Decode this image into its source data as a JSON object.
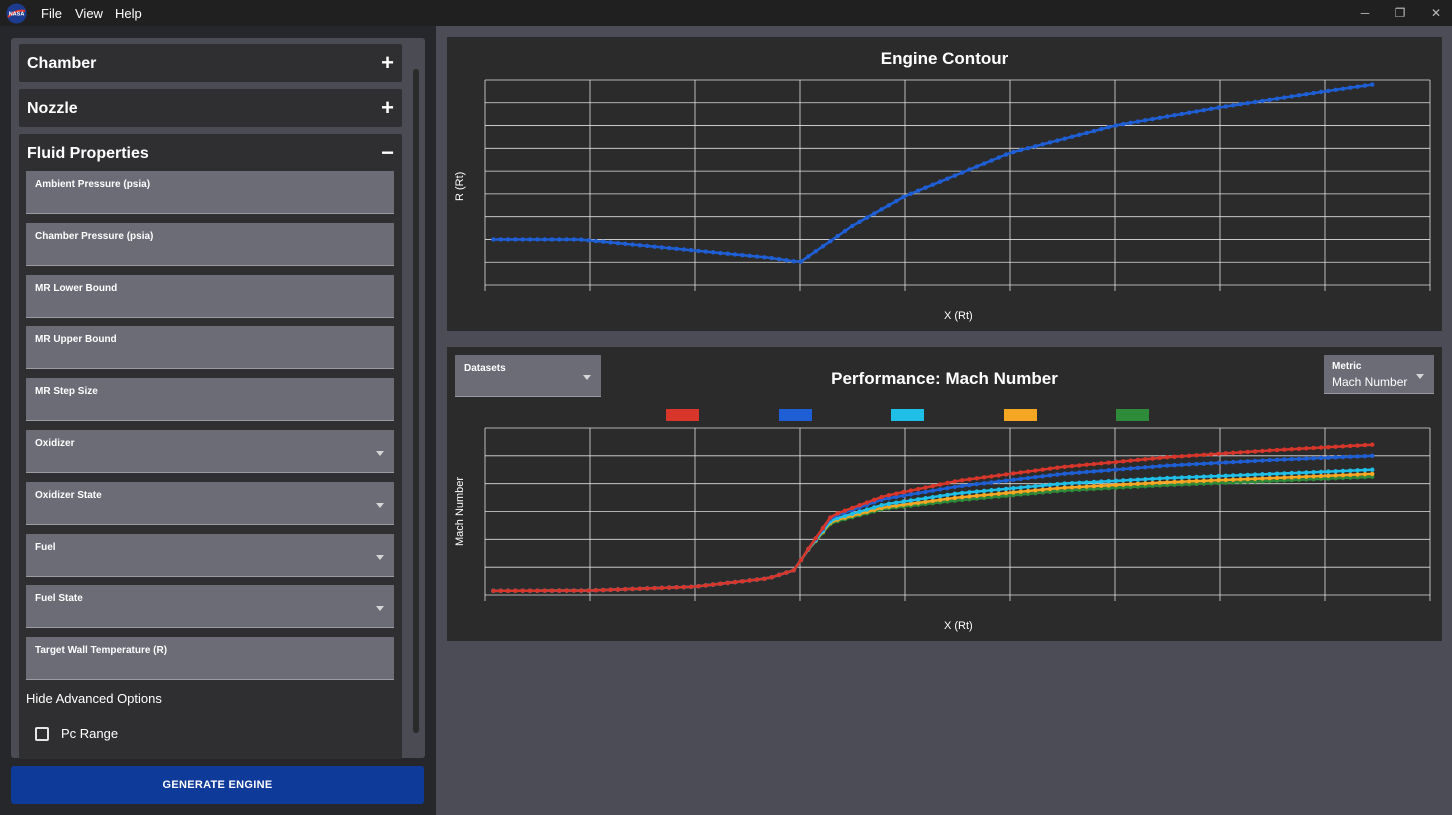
{
  "menu": {
    "items": [
      "File",
      "View",
      "Help"
    ]
  },
  "window_controls": {
    "minimize": "─",
    "restore": "❐",
    "close": "✕"
  },
  "sections": [
    {
      "title": "Chamber",
      "toggle": "+"
    },
    {
      "title": "Nozzle",
      "toggle": "+"
    },
    {
      "title": "Fluid Properties",
      "toggle": "−"
    }
  ],
  "fields": [
    {
      "label": "Ambient Pressure (psia)",
      "dropdown": false
    },
    {
      "label": "Chamber Pressure (psia)",
      "dropdown": false
    },
    {
      "label": "MR Lower Bound",
      "dropdown": false
    },
    {
      "label": "MR Upper Bound",
      "dropdown": false
    },
    {
      "label": "MR Step Size",
      "dropdown": false
    },
    {
      "label": "Oxidizer",
      "dropdown": true
    },
    {
      "label": "Oxidizer State",
      "dropdown": true
    },
    {
      "label": "Fuel",
      "dropdown": true
    },
    {
      "label": "Fuel State",
      "dropdown": true
    },
    {
      "label": "Target Wall Temperature (R)",
      "dropdown": false
    }
  ],
  "advanced": {
    "toggle_label": "Hide Advanced Options",
    "pc_range_label": "Pc Range",
    "pc_range_checked": false
  },
  "generate_button": "GENERATE ENGINE",
  "contour_panel": {
    "title": "Engine Contour",
    "xlabel": "X (Rt)",
    "ylabel": "R (Rt)"
  },
  "performance_panel": {
    "title": "Performance: Mach Number",
    "xlabel": "X (Rt)",
    "ylabel": "Mach Number",
    "datasets_label": "Datasets",
    "metric_label": "Metric",
    "metric_value": "Mach Number"
  },
  "colors": {
    "contour_line": "#1f5fd6",
    "grid": "#e0e0e0",
    "series": [
      "#d9362b",
      "#1f5fd6",
      "#1fbfe8",
      "#f5a623",
      "#2e8b3a"
    ]
  },
  "chart_data": [
    {
      "type": "scatter",
      "title": "Engine Contour",
      "xlabel": "X (Rt)",
      "ylabel": "R (Rt)",
      "grid": true,
      "xlim": [
        0,
        9
      ],
      "ylim": [
        0,
        9
      ],
      "series": [
        {
          "x": [
            0.08,
            0.9,
            1.8,
            2.7,
            3.0,
            3.5,
            4.0,
            5.0,
            6.0,
            7.0,
            8.0,
            8.45
          ],
          "values": [
            2.0,
            2.0,
            1.6,
            1.2,
            1.0,
            2.6,
            3.9,
            5.8,
            7.0,
            7.8,
            8.5,
            8.8
          ]
        }
      ]
    },
    {
      "type": "scatter",
      "title": "Performance: Mach Number",
      "xlabel": "X (Rt)",
      "ylabel": "Mach Number",
      "grid": true,
      "legend": "top-center",
      "xlim": [
        0,
        9
      ],
      "ylim": [
        0,
        6
      ],
      "series": [
        {
          "color": "#2e8b3a",
          "x": [
            0.08,
            1.0,
            2.0,
            2.7,
            2.95,
            3.05,
            3.3,
            3.8,
            4.5,
            5.5,
            6.5,
            7.5,
            8.45
          ],
          "values": [
            0.15,
            0.16,
            0.3,
            0.6,
            0.9,
            1.5,
            2.6,
            3.1,
            3.4,
            3.75,
            3.95,
            4.1,
            4.25
          ]
        },
        {
          "color": "#f5a623",
          "x": [
            0.08,
            1.0,
            2.0,
            2.7,
            2.95,
            3.05,
            3.3,
            3.8,
            4.5,
            5.5,
            6.5,
            7.5,
            8.45
          ],
          "values": [
            0.15,
            0.16,
            0.3,
            0.6,
            0.9,
            1.5,
            2.65,
            3.15,
            3.5,
            3.85,
            4.05,
            4.2,
            4.35
          ]
        },
        {
          "color": "#1fbfe8",
          "x": [
            0.08,
            1.0,
            2.0,
            2.7,
            2.95,
            3.05,
            3.3,
            3.8,
            4.5,
            5.5,
            6.5,
            7.5,
            8.45
          ],
          "values": [
            0.15,
            0.16,
            0.3,
            0.6,
            0.9,
            1.5,
            2.7,
            3.25,
            3.65,
            4.0,
            4.2,
            4.35,
            4.5
          ]
        },
        {
          "color": "#1f5fd6",
          "x": [
            0.08,
            1.0,
            2.0,
            2.7,
            2.95,
            3.05,
            3.3,
            3.8,
            4.5,
            5.5,
            6.5,
            7.5,
            8.45
          ],
          "values": [
            0.15,
            0.16,
            0.3,
            0.6,
            0.9,
            1.5,
            2.8,
            3.45,
            3.9,
            4.35,
            4.65,
            4.85,
            5.0
          ]
        },
        {
          "color": "#d9362b",
          "x": [
            0.08,
            1.0,
            2.0,
            2.7,
            2.95,
            3.05,
            3.3,
            3.8,
            4.5,
            5.5,
            6.5,
            7.5,
            8.45
          ],
          "values": [
            0.15,
            0.16,
            0.3,
            0.6,
            0.9,
            1.5,
            2.85,
            3.55,
            4.1,
            4.6,
            4.95,
            5.2,
            5.4
          ]
        }
      ]
    }
  ]
}
